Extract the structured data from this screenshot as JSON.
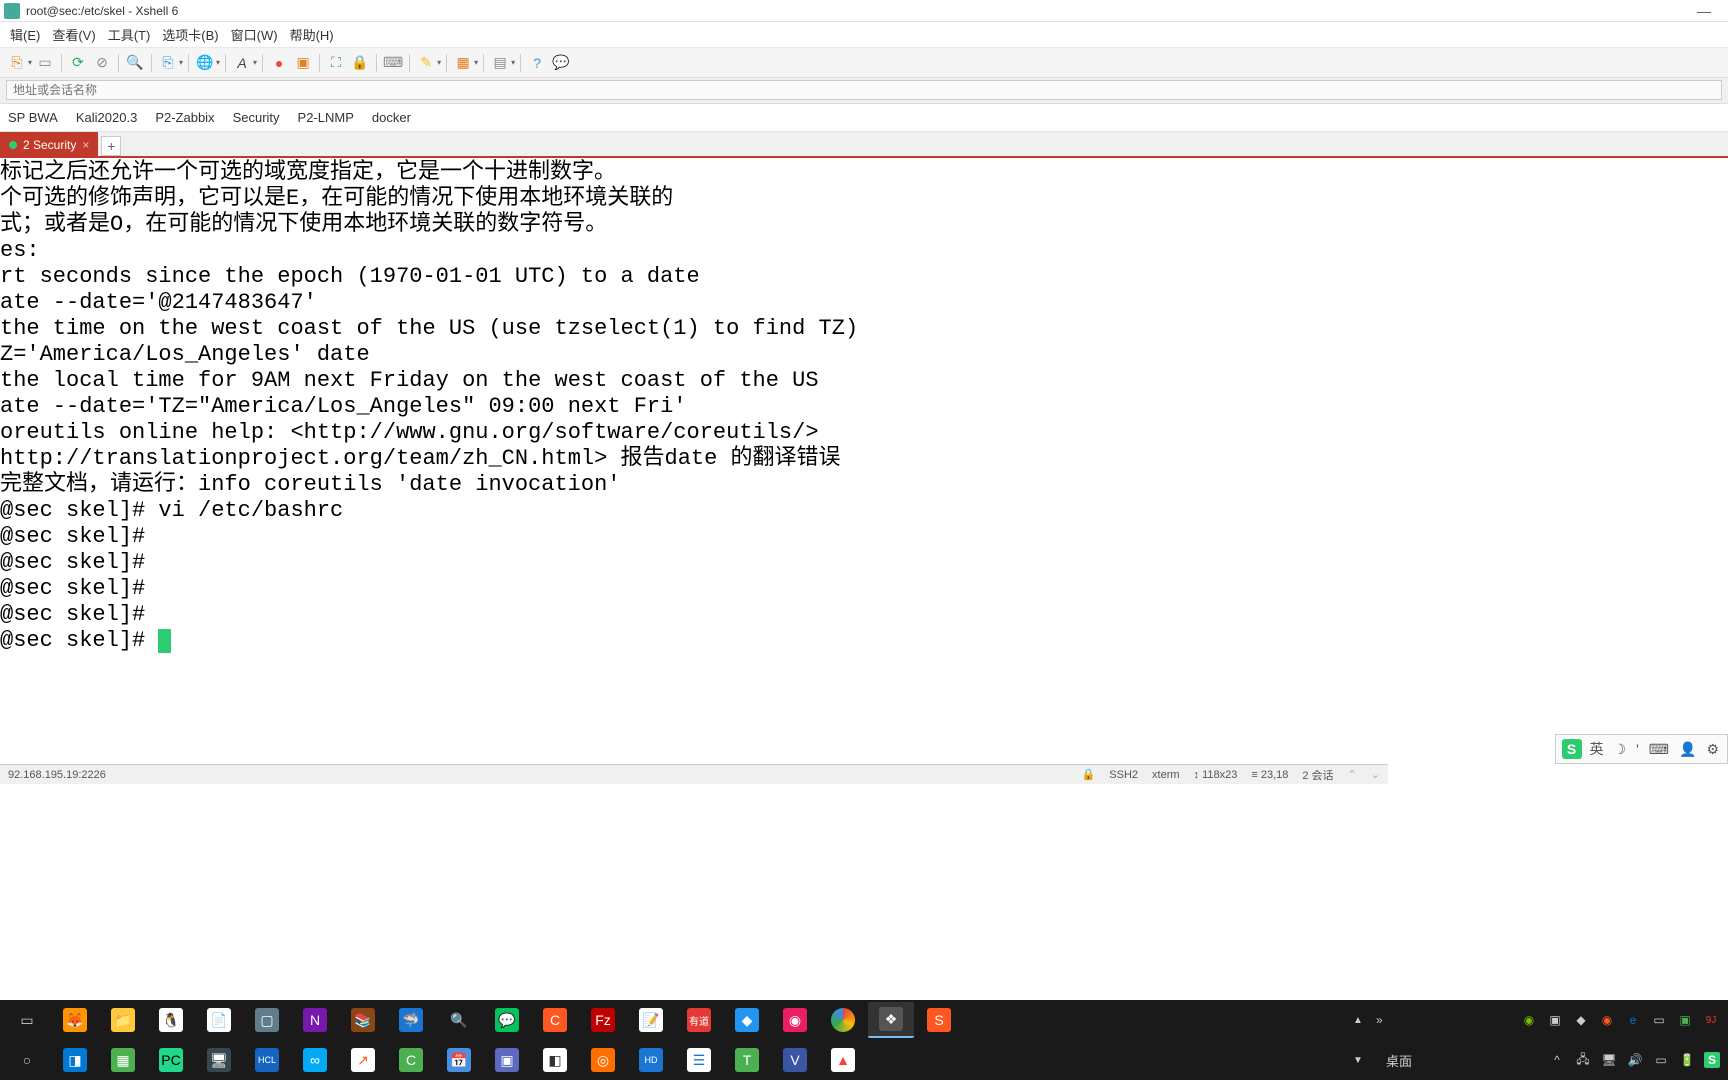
{
  "window": {
    "title": "root@sec:/etc/skel - Xshell 6"
  },
  "menu": {
    "edit": "辑(E)",
    "view": "查看(V)",
    "tools": "工具(T)",
    "tab": "选项卡(B)",
    "window": "窗口(W)",
    "help": "帮助(H)"
  },
  "address": {
    "placeholder": "地址或会话名称"
  },
  "quicklinks": {
    "l1": "SP BWA",
    "l2": "Kali2020.3",
    "l3": "P2-Zabbix",
    "l4": "Security",
    "l5": "P2-LNMP",
    "l6": "docker"
  },
  "tabs": {
    "t1": "2 Security"
  },
  "terminal": {
    "lines": [
      "标记之后还允许一个可选的域宽度指定，它是一个十进制数字。",
      "个可选的修饰声明，它可以是E，在可能的情况下使用本地环境关联的",
      "式；或者是O，在可能的情况下使用本地环境关联的数字符号。",
      "",
      "es:",
      "rt seconds since the epoch (1970-01-01 UTC) to a date",
      "ate --date='@2147483647'",
      "",
      "the time on the west coast of the US (use tzselect(1) to find TZ)",
      "Z='America/Los_Angeles' date",
      "",
      "the local time for 9AM next Friday on the west coast of the US",
      "ate --date='TZ=\"America/Los_Angeles\" 09:00 next Fri'",
      "",
      "oreutils online help: <http://www.gnu.org/software/coreutils/>",
      "http://translationproject.org/team/zh_CN.html> 报告date 的翻译错误",
      "完整文档，请运行：info coreutils 'date invocation'",
      "@sec skel]# vi /etc/bashrc",
      "@sec skel]#",
      "@sec skel]#",
      "@sec skel]#",
      "@sec skel]#",
      "@sec skel]# "
    ]
  },
  "status": {
    "left": "92.168.195.19:2226",
    "ssh": "SSH2",
    "term": "xterm",
    "size": "118x23",
    "pos": "23,18",
    "sessions": "2 会话"
  },
  "ime": {
    "lang": "英"
  },
  "taskbar": {
    "desktop": "桌面"
  }
}
